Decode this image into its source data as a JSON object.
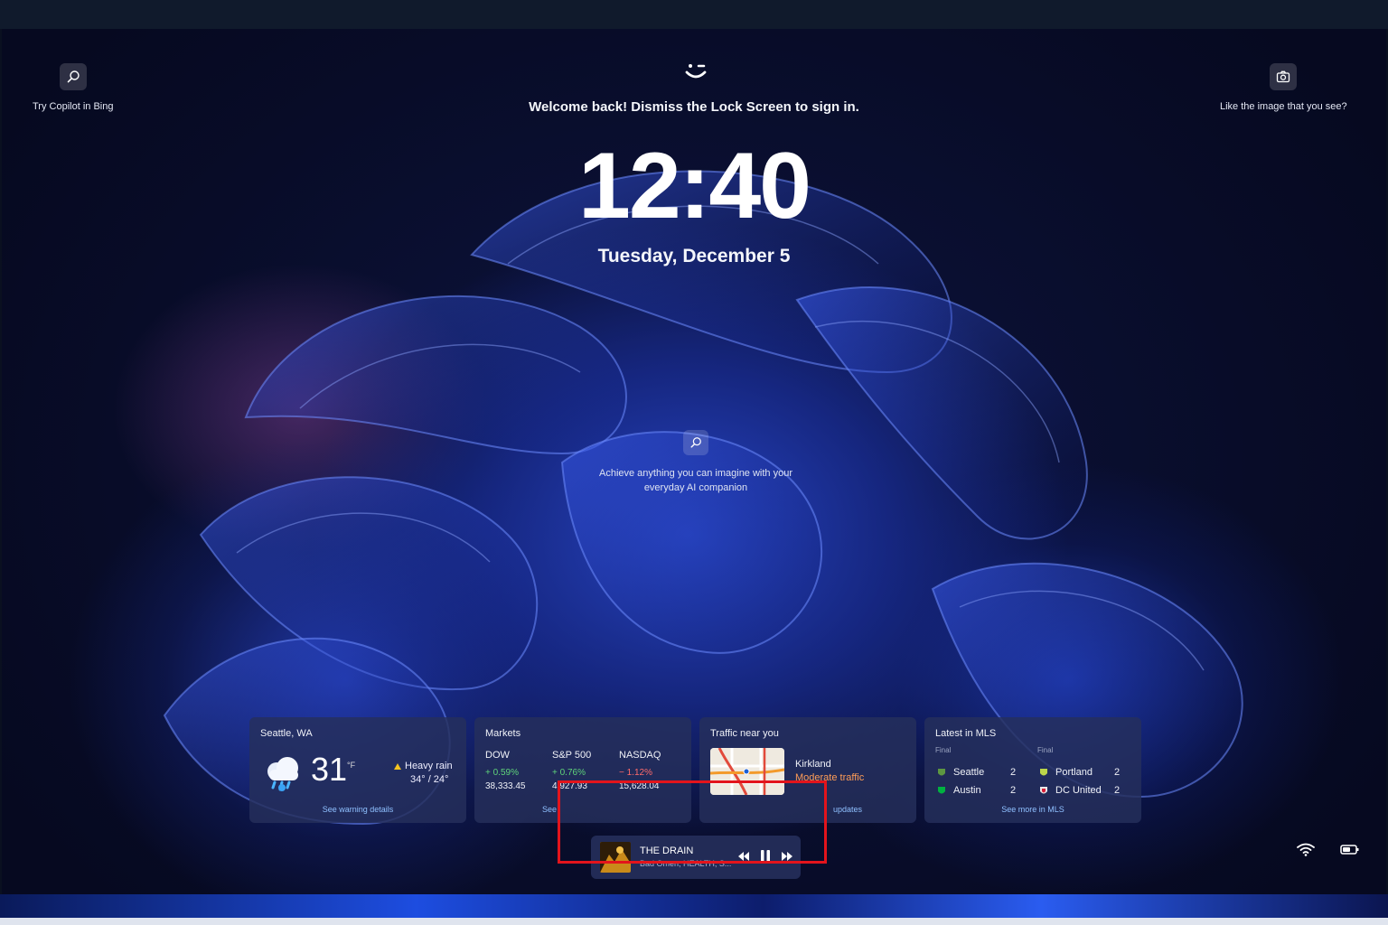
{
  "lock_screen": {
    "copilot_label": "Try Copilot in Bing",
    "camera_label": "Like the image that you see?",
    "welcome": "Welcome back! Dismiss the Lock Screen to sign in.",
    "time": "12:40",
    "date": "Tuesday, December 5",
    "center_prompt_line1": "Achieve anything you can imagine with your",
    "center_prompt_line2": "everyday AI companion"
  },
  "weather": {
    "location": "Seattle, WA",
    "temp": "31",
    "unit": "°F",
    "condition": "Heavy rain",
    "range": "34° / 24°",
    "link": "See warning details"
  },
  "markets": {
    "title": "Markets",
    "indices": [
      {
        "name": "DOW",
        "change": "+ 0.59%",
        "value": "38,333.45",
        "direction": "up"
      },
      {
        "name": "S&P 500",
        "change": "+ 0.76%",
        "value": "4,927.93",
        "direction": "up"
      },
      {
        "name": "NASDAQ",
        "change": "− 1.12%",
        "value": "15,628.04",
        "direction": "down"
      }
    ],
    "link": "See"
  },
  "traffic": {
    "title": "Traffic near you",
    "city": "Kirkland",
    "status": "Moderate traffic",
    "link": "updates"
  },
  "mls": {
    "title": "Latest in MLS",
    "final_label": "Final",
    "matches": [
      {
        "home": "Seattle",
        "home_score": "2",
        "away": "Austin",
        "away_score": "2"
      },
      {
        "home": "Portland",
        "home_score": "2",
        "away": "DC United",
        "away_score": "2"
      }
    ],
    "link": "See more in MLS"
  },
  "media": {
    "track": "THE DRAIN",
    "artist": "Bad Omen, HEALTH, S..."
  },
  "colors": {
    "accent_link": "#8fc0ff",
    "up": "#5fd37a",
    "down": "#ff6b6b",
    "traffic_moderate": "#ff9d57",
    "highlight": "#e3141c"
  },
  "icons": [
    "search-icon",
    "camera-icon",
    "face-sign-in-icon",
    "heavy-rain-icon",
    "warning-icon",
    "previous-track-icon",
    "pause-icon",
    "next-track-icon",
    "wifi-icon",
    "battery-icon"
  ]
}
